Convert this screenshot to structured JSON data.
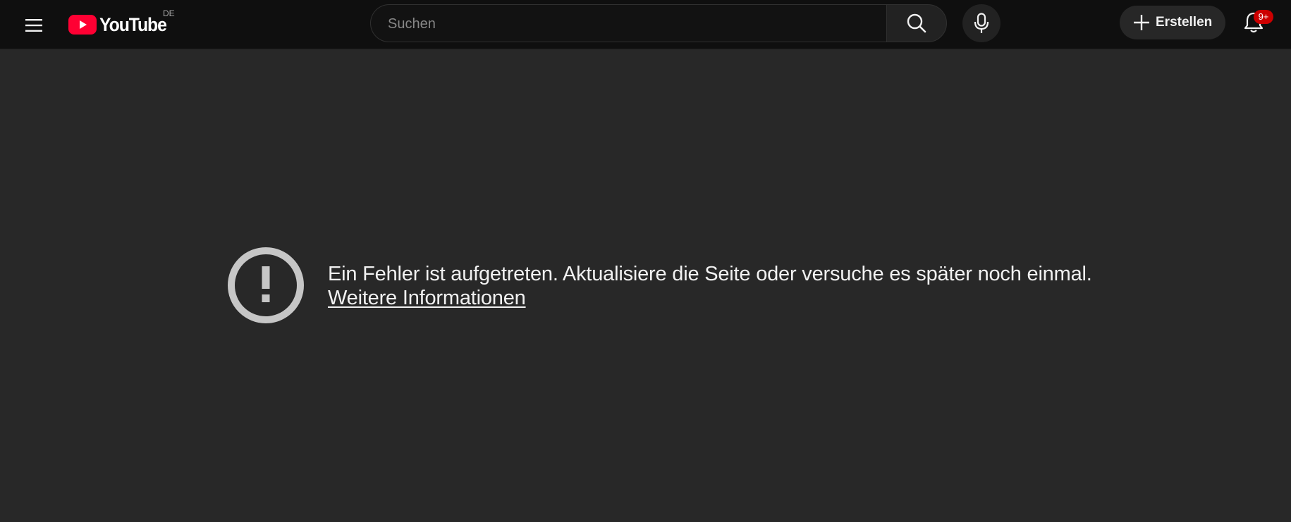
{
  "header": {
    "menu_icon": "hamburger-menu-icon",
    "logo": {
      "wordmark": "YouTube",
      "region": "DE",
      "brand_color": "#ff0033"
    },
    "search": {
      "placeholder": "Suchen",
      "value": ""
    },
    "search_icon": "search-icon",
    "mic_icon": "microphone-icon",
    "create": {
      "label": "Erstellen",
      "icon": "plus-icon"
    },
    "notifications": {
      "icon": "bell-icon",
      "badge": "9+",
      "badge_color": "#cc0000"
    }
  },
  "error": {
    "icon": "exclamation-circle-icon",
    "message": "Ein Fehler ist aufgetreten. Aktualisiere die Seite oder versuche es später noch einmal.",
    "link_label": "Weitere Informationen"
  },
  "colors": {
    "topbar_bg": "#0f0f0f",
    "page_bg": "#282828",
    "text": "#f1f1f1"
  }
}
